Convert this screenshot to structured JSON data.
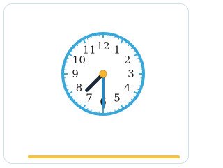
{
  "clock": {
    "numbers": [
      "12",
      "1",
      "2",
      "3",
      "4",
      "5",
      "6",
      "7",
      "8",
      "9",
      "10",
      "11"
    ],
    "time": {
      "hour": 7,
      "minute": 30
    },
    "colors": {
      "rim": "#3aa7d8",
      "hour_hand": "#1e2a3a",
      "minute_hand": "#2a86b8",
      "center": "#f5b731",
      "ticks": "#3aa7d8"
    }
  },
  "answer_line": {
    "color": "#f5c242"
  }
}
